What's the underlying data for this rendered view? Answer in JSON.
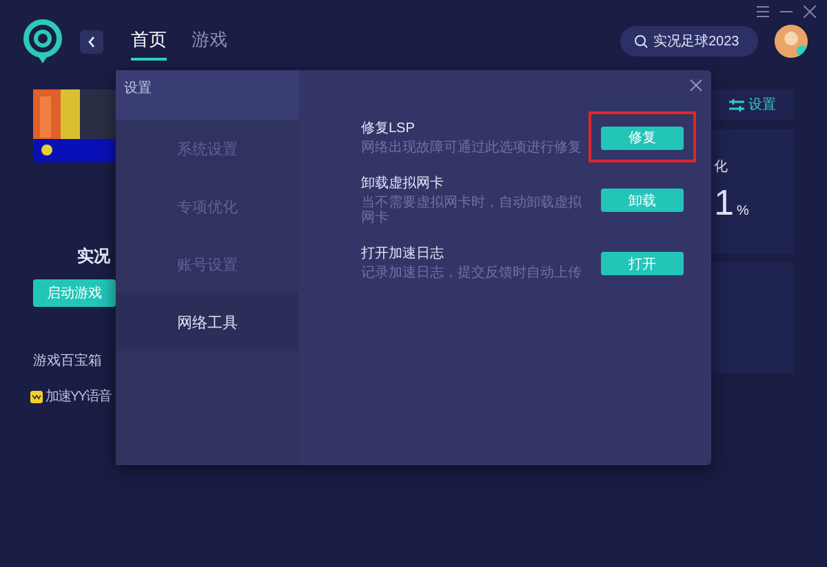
{
  "window": {
    "tabs": [
      {
        "label": "首页",
        "selected": true
      },
      {
        "label": "游戏",
        "selected": false
      }
    ],
    "search": {
      "value": "实况足球2023"
    }
  },
  "game": {
    "title": "实况",
    "button": "启动游戏"
  },
  "toolbox": {
    "title": "游戏百宝箱",
    "items": [
      {
        "label": "加速YY语音"
      }
    ]
  },
  "side_panel": {
    "settings_button": "设置",
    "card_label": "化",
    "value": "1",
    "unit": "%"
  },
  "dialog": {
    "title": "设置",
    "nav": [
      {
        "label": "系统设置",
        "selected": false
      },
      {
        "label": "专项优化",
        "selected": false
      },
      {
        "label": "账号设置",
        "selected": false
      },
      {
        "label": "网络工具",
        "selected": true
      }
    ],
    "tools": [
      {
        "title": "修复LSP",
        "description": "网络出现故障可通过此选项进行修复",
        "button": "修复",
        "highlighted": true
      },
      {
        "title": "卸载虚拟网卡",
        "description": "当不需要虚拟网卡时，自动卸载虚拟网卡",
        "button": "卸载",
        "highlighted": false
      },
      {
        "title": "打开加速日志",
        "description": "记录加速日志，提交反馈时自动上传",
        "button": "打开",
        "highlighted": false
      }
    ]
  }
}
